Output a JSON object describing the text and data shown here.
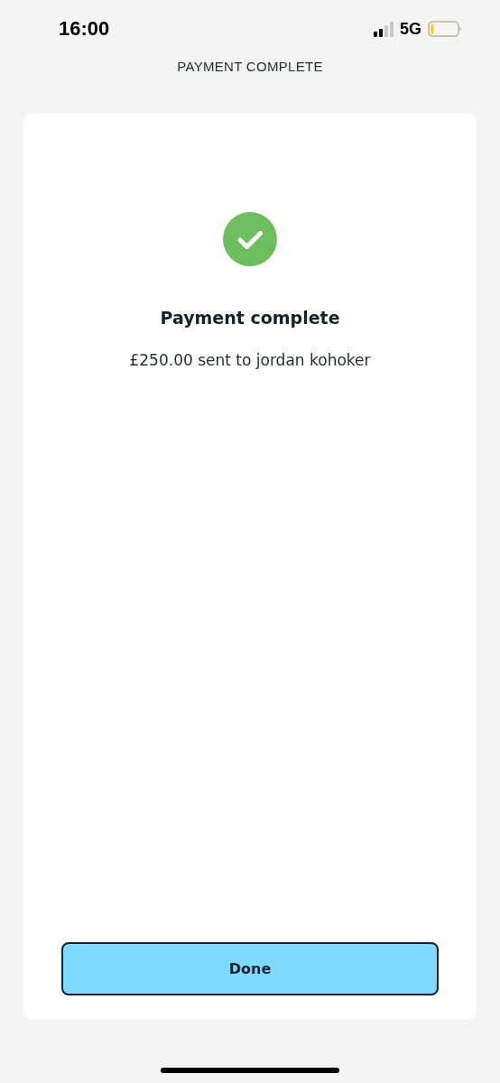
{
  "status_bar": {
    "time": "16:00",
    "network": "5G"
  },
  "header": {
    "title": "PAYMENT COMPLETE"
  },
  "confirmation": {
    "title": "Payment complete",
    "message": "£250.00 sent to jordan kohoker"
  },
  "buttons": [
    "Done"
  ]
}
